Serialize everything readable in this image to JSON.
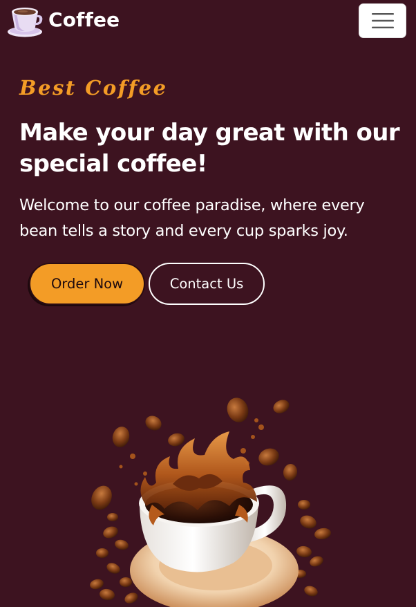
{
  "navbar": {
    "brand_name": "Coffee",
    "logo_icon": "coffee-cup-icon",
    "menu_icon": "hamburger-menu-icon"
  },
  "hero": {
    "eyebrow": "Best Coffee",
    "headline": "Make your day great with our special coffee!",
    "intro": "Welcome to our coffee paradise, where every bean tells a story and every cup sparks joy.",
    "primary_button": "Order Now",
    "secondary_button": "Contact Us",
    "image_icon": "coffee-splash-illustration"
  },
  "colors": {
    "background": "#3d1320",
    "accent": "#f39c26",
    "text": "#ffffff"
  }
}
